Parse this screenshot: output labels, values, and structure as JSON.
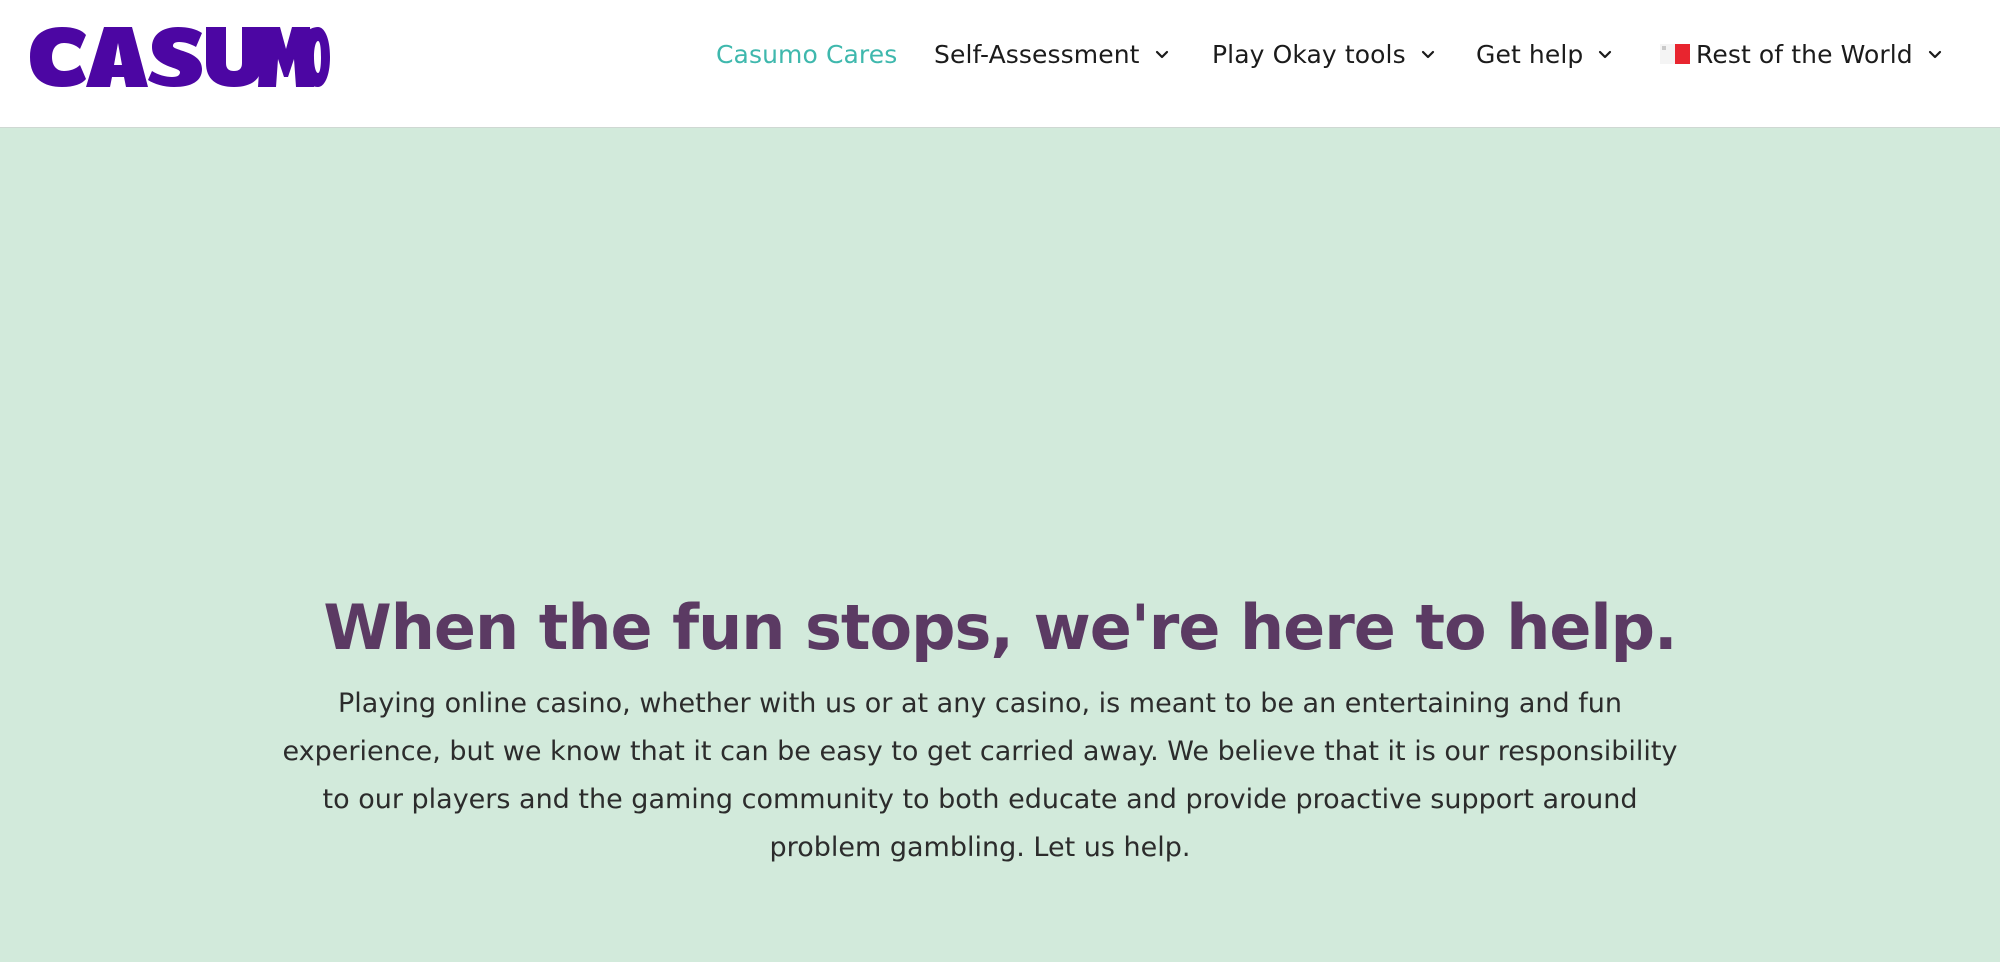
{
  "brand": {
    "logo_text": "CASUMO",
    "logo_color": "#4c06a3"
  },
  "nav": {
    "items": [
      {
        "label": "Casumo Cares",
        "active": true,
        "has_dropdown": false
      },
      {
        "label": "Self-Assessment",
        "active": false,
        "has_dropdown": true
      },
      {
        "label": "Play Okay tools",
        "active": false,
        "has_dropdown": true
      },
      {
        "label": "Get help",
        "active": false,
        "has_dropdown": true
      },
      {
        "label": "Rest of the World",
        "active": false,
        "has_dropdown": true,
        "icon": "malta-flag-icon"
      }
    ],
    "active_color": "#3fb8ad"
  },
  "hero": {
    "title": "When the fun stops, we're here to help.",
    "body": "Playing online casino, whether with us or at any casino, is meant to be an entertaining and fun experience, but we know that it can be easy to get carried away. We believe that it is our responsibility to our players and the gaming community to both educate and provide proactive support around problem gambling. Let us help.",
    "background_color": "#d2eadb",
    "title_color": "#5b3a63"
  }
}
